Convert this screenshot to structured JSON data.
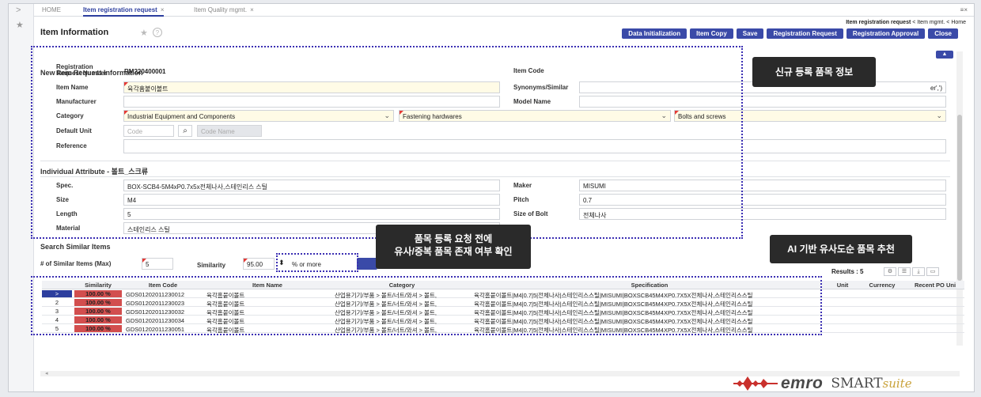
{
  "tabs": [
    {
      "label": "HOME"
    },
    {
      "label": "Item registration request"
    },
    {
      "label": "Item Quality mgmt."
    }
  ],
  "tab_close": "×",
  "tab_menu_icon": "≡×",
  "breadcrumb": {
    "current": "Item registration request",
    "sep": "<",
    "parent": "Item mgmt.",
    "root": "Home"
  },
  "page_title": "Item Information",
  "toolbar": [
    "Data Initialization",
    "Item Copy",
    "Save",
    "Registration Request",
    "Registration Approval",
    "Close"
  ],
  "sections": {
    "new_item": "New Item Request Information",
    "attributes": "Individual Attribute - 볼트_스크류",
    "search": "Search Similar Items"
  },
  "form": {
    "request_number_label": "Registration Request Number",
    "request_number": "RM220400001",
    "item_code_label": "Item Code",
    "item_name_label": "Item Name",
    "item_name": "육각홈붙이볼트",
    "synonyms_label": "Synonyms/Similar",
    "synonyms_hint": "er',')",
    "manufacturer_label": "Manufacturer",
    "model_name_label": "Model Name",
    "category_label": "Category",
    "category_1": "Industrial Equipment and Components",
    "category_2": "Fastening hardwares",
    "category_3": "Bolts and screws",
    "default_unit_label": "Default Unit",
    "code_placeholder": "Code",
    "code_name_placeholder": "Code Name",
    "reference_label": "Reference"
  },
  "attributes": {
    "spec_label": "Spec.",
    "spec": "BOX-SCB4-5M4xP0.7x5x전체나사,스테인리스 스틸",
    "maker_label": "Maker",
    "maker": "MISUMI",
    "size_label": "Size",
    "size": "M4",
    "pitch_label": "Pitch",
    "pitch": "0.7",
    "length_label": "Length",
    "length": "5",
    "size_of_bolt_label": "Size of Bolt",
    "size_of_bolt": "전체나사",
    "material_label": "Material",
    "material": "스테인리스 스틸"
  },
  "search": {
    "max_label": "# of Similar Items (Max)",
    "max_value": "5",
    "similarity_label": "Similarity",
    "similarity_value": "95.00",
    "or_more": "% or more",
    "results": "Results : 5"
  },
  "callouts": {
    "new_item": "신규 등록 품목 정보",
    "check_line1": "품목 등록 요청 전에",
    "check_line2": "유사/중복 품목 존재 여부 확인",
    "ai": "AI 기반 유사도순 품목 추천"
  },
  "grid": {
    "headers": [
      "Similarity",
      "Item Code",
      "Item Name",
      "Category",
      "Specification",
      "Unit",
      "Currency",
      "Recent PO Uni"
    ],
    "rows": [
      {
        "no": ">",
        "similarity": "100.00 %",
        "code": "GDS01202011230012",
        "name": "육각홈붙이볼트",
        "category": "산업용기기/부품 > 볼트/너트/와셔 > 볼트,",
        "spec": "육각홈붙이볼트|M4|0.7|5|전체나사|스테인리스스틸|MISUMI|BOXSCB45M4XP0.7X5X전체나사,스테인리스스틸"
      },
      {
        "no": "2",
        "similarity": "100.00 %",
        "code": "GDS01202011230023",
        "name": "육각홈붙이볼트",
        "category": "산업용기기/부품 > 볼트/너트/와셔 > 볼트,",
        "spec": "육각홈붙이볼트|M4|0.7|5|전체나사|스테인리스스틸|MISUMI|BOXSCB45M4XP0.7X5X전체나사,스테인리스스틸"
      },
      {
        "no": "3",
        "similarity": "100.00 %",
        "code": "GDS01202011230032",
        "name": "육각홈붙이볼트",
        "category": "산업용기기/부품 > 볼트/너트/와셔 > 볼트,",
        "spec": "육각홈붙이볼트|M4|0.7|5|전체나사|스테인리스스틸|MISUMI|BOXSCB45M4XP0.7X5X전체나사,스테인리스스틸"
      },
      {
        "no": "4",
        "similarity": "100.00 %",
        "code": "GDS01202011230034",
        "name": "육각홈붙이볼트",
        "category": "산업용기기/부품 > 볼트/너트/와셔 > 볼트,",
        "spec": "육각홈붙이볼트|M4|0.7|5|전체나사|스테인리스스틸|MISUMI|BOXSCB45M4XP0.7X5X전체나사,스테인리스스틸"
      },
      {
        "no": "5",
        "similarity": "100.00 %",
        "code": "GDS01202011230051",
        "name": "육각홈붙이볼트",
        "category": "산업용기기/부품 > 볼트/너트/와셔 > 볼트,",
        "spec": "육각홈붙이볼트|M4|0.7|5|전체나사|스테인리스스틸|MISUMI|BOXSCB45M4XP0.7X5X전체나사,스테인리스스틸"
      }
    ]
  },
  "logo": {
    "brand": "emro",
    "product": "SMART",
    "suffix": "suite"
  },
  "icons": {
    "expand": "chevron-right-icon",
    "favorite": "star-icon",
    "help": "help-icon",
    "dropdown": "chevron-down-icon",
    "search": "magnifier-icon",
    "collapse": "chevron-up-icon"
  },
  "colors": {
    "accent": "#3a4aa8",
    "similarity": "#d24e4e",
    "required_bg": "#fffbe6",
    "annotation": "#3b2fb3"
  }
}
